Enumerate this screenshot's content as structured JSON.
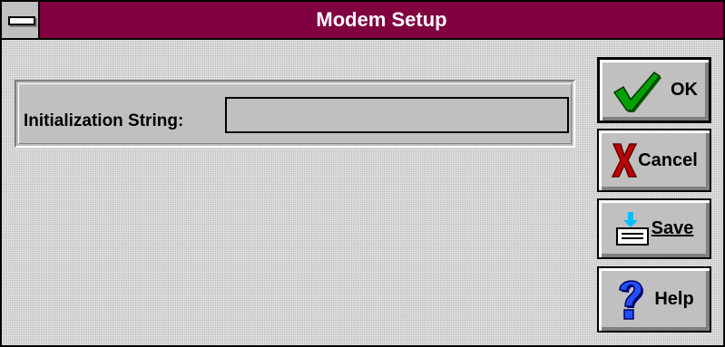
{
  "window": {
    "title": "Modem Setup"
  },
  "form": {
    "init_string_label": "Initialization String:",
    "init_string_value": ""
  },
  "buttons": {
    "ok_label": "OK",
    "cancel_label": "Cancel",
    "save_label": "Save",
    "help_label": "Help"
  },
  "icons": {
    "system_menu": "system-menu-icon",
    "ok": "checkmark-icon",
    "cancel": "x-icon",
    "save": "save-icon",
    "help": "question-mark-icon"
  },
  "colors": {
    "titlebar": "#800040",
    "face": "#c0c0c0",
    "checkmark": "#008000",
    "cross": "#c00000",
    "help": "#0000c0",
    "save_arrow": "#00c0ff"
  }
}
